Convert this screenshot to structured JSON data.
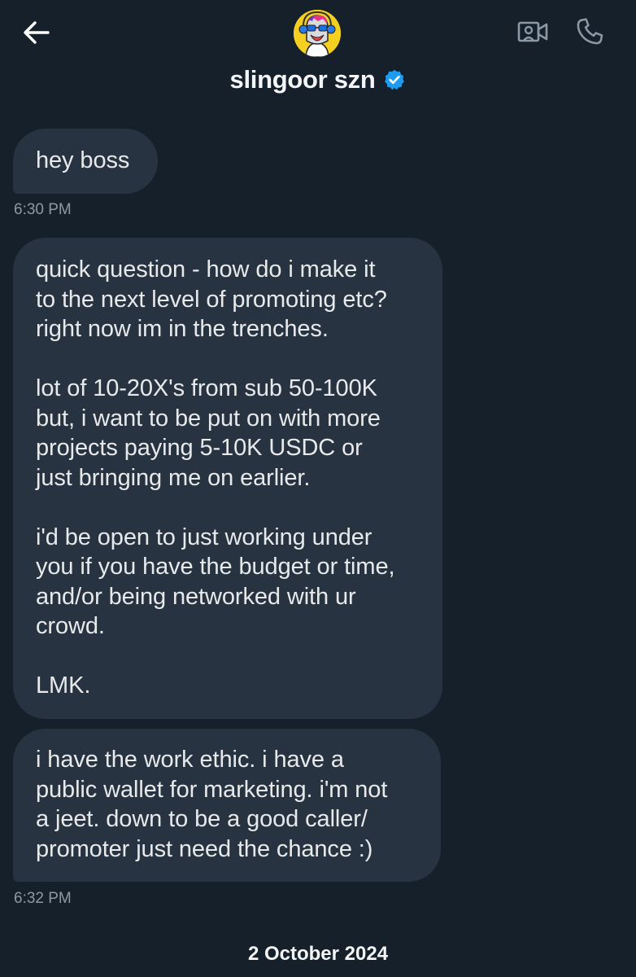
{
  "header": {
    "contact_name": "slingoor szn",
    "verified": true,
    "icons": [
      "back-arrow-icon",
      "avatar",
      "verified-badge-icon",
      "video-camera-icon",
      "phone-icon"
    ],
    "accent_color": "#1d9bf0"
  },
  "messages": [
    {
      "text": "hey boss",
      "timestamp": "6:30 PM"
    },
    {
      "text": "quick question - how do i make it\nto the next level of promoting etc?\nright now im in the trenches.\n\nlot of 10-20X's from sub 50-100K\nbut, i want to be put on with more\nprojects paying 5-10K USDC or\njust bringing me on earlier.\n\ni'd be open to just working under\nyou if you have the budget or time,\nand/or being networked with ur\ncrowd.\n\nLMK."
    },
    {
      "text": "i have the work ethic. i have a\npublic wallet for marketing. i'm not\na jeet. down to be a good caller/\npromoter just need the chance :)",
      "timestamp": "6:32 PM"
    }
  ],
  "date_separator": "2 October 2024",
  "colors": {
    "background": "#15202b",
    "bubble": "#273340",
    "text": "#e7e9ea",
    "muted": "#8b98a5"
  }
}
